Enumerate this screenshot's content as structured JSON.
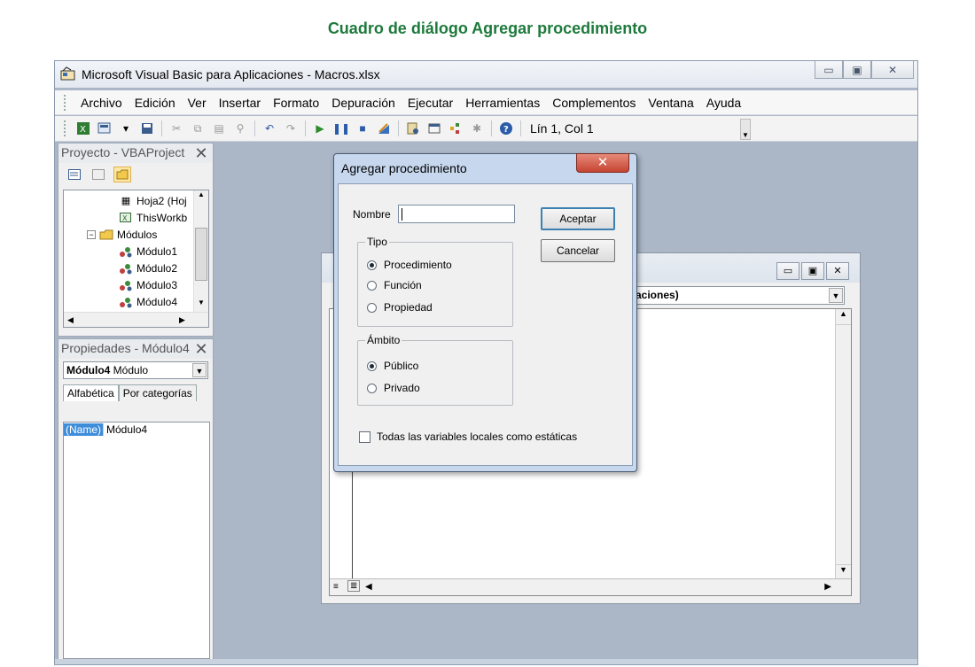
{
  "caption": "Cuadro de diálogo Agregar procedimiento",
  "window": {
    "title": "Microsoft Visual Basic para Aplicaciones - Macros.xlsx",
    "minimize": "▭",
    "restore": "▣",
    "close": "✕"
  },
  "menu": {
    "items": [
      "Archivo",
      "Edición",
      "Ver",
      "Insertar",
      "Formato",
      "Depuración",
      "Ejecutar",
      "Herramientas",
      "Complementos",
      "Ventana",
      "Ayuda"
    ]
  },
  "toolbar": {
    "position_text": "Lín 1, Col 1"
  },
  "project_panel": {
    "title": "Proyecto - VBAProject",
    "close_glyph": "✕",
    "tree": {
      "hoja2": "Hoja2 (Hoj",
      "thisworkbook": "ThisWorkb",
      "modulos": "Módulos",
      "modulo1": "Módulo1",
      "modulo2": "Módulo2",
      "modulo3": "Módulo3",
      "modulo4": "Módulo4"
    }
  },
  "properties_panel": {
    "title": "Propiedades - Módulo4",
    "close_glyph": "✕",
    "selected_object_name": "Módulo4",
    "selected_object_type": "Módulo",
    "tabs": [
      "Alfabética",
      "Por categorías"
    ],
    "rows": [
      {
        "name": "(Name)",
        "value": "Módulo4"
      }
    ]
  },
  "code_window": {
    "procedure_combo": "aciones)"
  },
  "dialog": {
    "title": "Agregar procedimiento",
    "nombre_label": "Nombre",
    "nombre_value": "",
    "accept_label": "Aceptar",
    "cancel_label": "Cancelar",
    "tipo_legend": "Tipo",
    "tipo_options": [
      "Procedimiento",
      "Función",
      "Propiedad"
    ],
    "tipo_selected": "Procedimiento",
    "ambito_legend": "Ámbito",
    "ambito_options": [
      "Público",
      "Privado"
    ],
    "ambito_selected": "Público",
    "static_checkbox_label": "Todas las variables locales como estáticas",
    "static_checked": false
  },
  "colors": {
    "caption": "#1d7a3c",
    "dialog_frame": "#c6d7ee",
    "close_button": "#c64331",
    "workspace": "#abb6c6"
  }
}
